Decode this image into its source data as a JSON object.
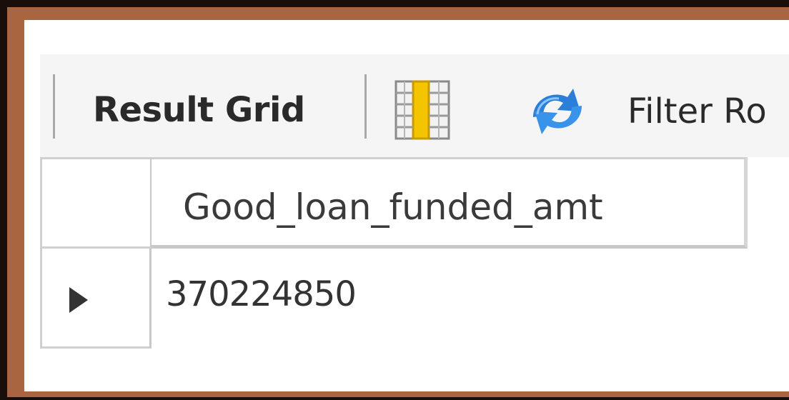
{
  "toolbar": {
    "result_grid_label": "Result Grid",
    "grid_icon": "grid-layout-icon",
    "refresh_icon": "refresh-icon",
    "filter_label": "Filter Ro"
  },
  "grid": {
    "columns": [
      "Good_loan_funded_amt"
    ],
    "rows": [
      [
        "370224850"
      ]
    ]
  },
  "colors": {
    "frame_border": "#a8653f",
    "outer_background": "#1a0e0b",
    "toolbar_background": "#f5f5f5",
    "grid_icon_accent": "#f5c400",
    "refresh_icon_color": "#2b7fd9"
  }
}
